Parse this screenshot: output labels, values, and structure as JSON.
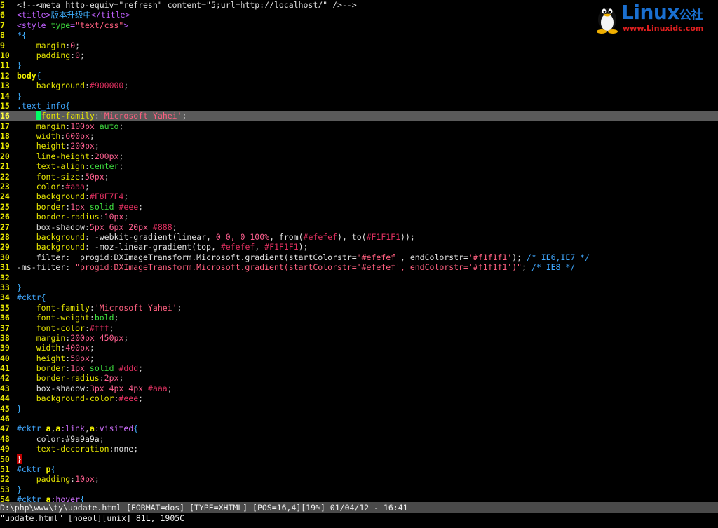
{
  "editor": {
    "lines": [
      {
        "n": "5",
        "tokens": [
          [
            "c-cmt",
            "<!--<meta http-equiv=\"refresh\" content=\"5;url=http://localhost/\" />-->"
          ]
        ]
      },
      {
        "n": "6",
        "tokens": [
          [
            "c-tag",
            "<title>"
          ],
          [
            "c-txt",
            "版本升级中"
          ],
          [
            "c-tag",
            "</title>"
          ]
        ]
      },
      {
        "n": "7",
        "tokens": [
          [
            "c-tag",
            "<style "
          ],
          [
            "c-val",
            "type"
          ],
          [
            "c-tag",
            "="
          ],
          [
            "c-str",
            "\"text/css\""
          ],
          [
            "c-tag",
            ">"
          ]
        ]
      },
      {
        "n": "8",
        "tokens": [
          [
            "c-sel",
            "*"
          ],
          [
            "c-brace",
            "{"
          ]
        ]
      },
      {
        "n": "9",
        "tokens": [
          [
            "",
            "    "
          ],
          [
            "c-prop",
            "margin"
          ],
          [
            "",
            ":"
          ],
          [
            "c-num",
            "0"
          ],
          [
            "",
            ";"
          ]
        ]
      },
      {
        "n": "10",
        "tokens": [
          [
            "",
            "    "
          ],
          [
            "c-prop",
            "padding"
          ],
          [
            "",
            ":"
          ],
          [
            "c-num",
            "0"
          ],
          [
            "",
            ";"
          ]
        ]
      },
      {
        "n": "11",
        "tokens": [
          [
            "c-brace",
            "}"
          ]
        ]
      },
      {
        "n": "12",
        "tokens": [
          [
            "c-propb",
            "body"
          ],
          [
            "c-brace",
            "{"
          ]
        ]
      },
      {
        "n": "13",
        "tokens": [
          [
            "",
            "    "
          ],
          [
            "c-prop",
            "background"
          ],
          [
            "",
            ":"
          ],
          [
            "c-hex",
            "#900000"
          ],
          [
            "",
            ";"
          ]
        ]
      },
      {
        "n": "14",
        "tokens": [
          [
            "c-brace",
            "}"
          ]
        ]
      },
      {
        "n": "15",
        "tokens": [
          [
            "c-sel",
            ".text_info"
          ],
          [
            "c-brace",
            "{"
          ]
        ]
      },
      {
        "n": "16",
        "cur": true,
        "tokens": [
          [
            "",
            "    "
          ],
          [
            "cursor",
            ""
          ],
          [
            "c-prop",
            "font-family"
          ],
          [
            "",
            ":"
          ],
          [
            "c-str",
            "'Microsoft Yahei'"
          ],
          [
            "",
            ";"
          ]
        ]
      },
      {
        "n": "17",
        "tokens": [
          [
            "",
            "    "
          ],
          [
            "c-prop",
            "margin"
          ],
          [
            "",
            ":"
          ],
          [
            "c-num",
            "100px"
          ],
          [
            "",
            " "
          ],
          [
            "c-val",
            "auto"
          ],
          [
            "",
            ";"
          ]
        ]
      },
      {
        "n": "18",
        "tokens": [
          [
            "",
            "    "
          ],
          [
            "c-prop",
            "width"
          ],
          [
            "",
            ":"
          ],
          [
            "c-num",
            "600px"
          ],
          [
            "",
            ";"
          ]
        ]
      },
      {
        "n": "19",
        "tokens": [
          [
            "",
            "    "
          ],
          [
            "c-prop",
            "height"
          ],
          [
            "",
            ":"
          ],
          [
            "c-num",
            "200px"
          ],
          [
            "",
            ";"
          ]
        ]
      },
      {
        "n": "20",
        "tokens": [
          [
            "",
            "    "
          ],
          [
            "c-prop",
            "line-height"
          ],
          [
            "",
            ":"
          ],
          [
            "c-num",
            "200px"
          ],
          [
            "",
            ";"
          ]
        ]
      },
      {
        "n": "21",
        "tokens": [
          [
            "",
            "    "
          ],
          [
            "c-prop",
            "text-align"
          ],
          [
            "",
            ":"
          ],
          [
            "c-val",
            "center"
          ],
          [
            "",
            ";"
          ]
        ]
      },
      {
        "n": "22",
        "tokens": [
          [
            "",
            "    "
          ],
          [
            "c-prop",
            "font-size"
          ],
          [
            "",
            ":"
          ],
          [
            "c-num",
            "50px"
          ],
          [
            "",
            ";"
          ]
        ]
      },
      {
        "n": "23",
        "tokens": [
          [
            "",
            "    "
          ],
          [
            "c-prop",
            "color"
          ],
          [
            "",
            ":"
          ],
          [
            "c-hex",
            "#aaa"
          ],
          [
            "",
            ";"
          ]
        ]
      },
      {
        "n": "24",
        "tokens": [
          [
            "",
            "    "
          ],
          [
            "c-prop",
            "background"
          ],
          [
            "",
            ":"
          ],
          [
            "c-hex",
            "#F8F7F4"
          ],
          [
            "",
            ";"
          ]
        ]
      },
      {
        "n": "25",
        "tokens": [
          [
            "",
            "    "
          ],
          [
            "c-prop",
            "border"
          ],
          [
            "",
            ":"
          ],
          [
            "c-num",
            "1px"
          ],
          [
            "",
            " "
          ],
          [
            "c-val",
            "solid"
          ],
          [
            "",
            " "
          ],
          [
            "c-hex",
            "#eee"
          ],
          [
            "",
            ";"
          ]
        ]
      },
      {
        "n": "26",
        "tokens": [
          [
            "",
            "    "
          ],
          [
            "c-prop",
            "border-radius"
          ],
          [
            "",
            ":"
          ],
          [
            "c-num",
            "10px"
          ],
          [
            "",
            ";"
          ]
        ]
      },
      {
        "n": "27",
        "tokens": [
          [
            "",
            "    "
          ],
          [
            "c-fn",
            "box-shadow"
          ],
          [
            "",
            ":"
          ],
          [
            "c-num",
            "5px 6px 20px"
          ],
          [
            "",
            " "
          ],
          [
            "c-hex",
            "#888"
          ],
          [
            "",
            ";"
          ]
        ]
      },
      {
        "n": "28",
        "tokens": [
          [
            "",
            "    "
          ],
          [
            "c-prop",
            "background"
          ],
          [
            "",
            ": "
          ],
          [
            "c-fn",
            "-webkit-gradient(linear, "
          ],
          [
            "c-num",
            "0 0, 0 100%"
          ],
          [
            "c-fn",
            ", from("
          ],
          [
            "c-hex",
            "#efefef"
          ],
          [
            "c-fn",
            "), to("
          ],
          [
            "c-hex",
            "#F1F1F1"
          ],
          [
            "c-fn",
            "));"
          ]
        ]
      },
      {
        "n": "29",
        "tokens": [
          [
            "",
            "    "
          ],
          [
            "c-prop",
            "background"
          ],
          [
            "",
            ": "
          ],
          [
            "c-fn",
            "-moz-linear-gradient(top, "
          ],
          [
            "c-hex",
            "#efefef"
          ],
          [
            "c-fn",
            ", "
          ],
          [
            "c-hex",
            "#F1F1F1"
          ],
          [
            "c-fn",
            ");"
          ]
        ]
      },
      {
        "n": "30",
        "tokens": [
          [
            "",
            "    "
          ],
          [
            "c-fn",
            "filter:  progid:DXImageTransform.Microsoft.gradient(startColorstr="
          ],
          [
            "c-str",
            "'#efefef'"
          ],
          [
            "c-fn",
            ", endColorstr="
          ],
          [
            "c-str",
            "'#f1f1f1'"
          ],
          [
            "c-fn",
            "); "
          ],
          [
            "c-sel",
            "/* IE6,IE7 */"
          ]
        ]
      },
      {
        "n": "31",
        "tokens": [
          [
            "c-fn",
            "-ms-filter: "
          ],
          [
            "c-str",
            "\"progid:DXImageTransform.Microsoft.gradient(startColorstr='#efefef', endColorstr='#f1f1f1')\""
          ],
          [
            "c-fn",
            "; "
          ],
          [
            "c-sel",
            "/* IE8 */"
          ]
        ]
      },
      {
        "n": "32",
        "tokens": []
      },
      {
        "n": "33",
        "tokens": [
          [
            "c-brace",
            "}"
          ]
        ]
      },
      {
        "n": "34",
        "tokens": [
          [
            "c-sel",
            "#cktr"
          ],
          [
            "c-brace",
            "{"
          ]
        ]
      },
      {
        "n": "35",
        "tokens": [
          [
            "",
            "    "
          ],
          [
            "c-prop",
            "font-family"
          ],
          [
            "",
            ":"
          ],
          [
            "c-str",
            "'Microsoft Yahei'"
          ],
          [
            "",
            ";"
          ]
        ]
      },
      {
        "n": "36",
        "tokens": [
          [
            "",
            "    "
          ],
          [
            "c-prop",
            "font-weight"
          ],
          [
            "",
            ":"
          ],
          [
            "c-val",
            "bold"
          ],
          [
            "",
            ";"
          ]
        ]
      },
      {
        "n": "37",
        "tokens": [
          [
            "",
            "    "
          ],
          [
            "c-prop",
            "font-color"
          ],
          [
            "",
            ":"
          ],
          [
            "c-hex",
            "#fff"
          ],
          [
            "",
            ";"
          ]
        ]
      },
      {
        "n": "38",
        "tokens": [
          [
            "",
            "    "
          ],
          [
            "c-prop",
            "margin"
          ],
          [
            "",
            ":"
          ],
          [
            "c-num",
            "200px 450px"
          ],
          [
            "",
            ";"
          ]
        ]
      },
      {
        "n": "39",
        "tokens": [
          [
            "",
            "    "
          ],
          [
            "c-prop",
            "width"
          ],
          [
            "",
            ":"
          ],
          [
            "c-num",
            "400px"
          ],
          [
            "",
            ";"
          ]
        ]
      },
      {
        "n": "40",
        "tokens": [
          [
            "",
            "    "
          ],
          [
            "c-prop",
            "height"
          ],
          [
            "",
            ":"
          ],
          [
            "c-num",
            "50px"
          ],
          [
            "",
            ";"
          ]
        ]
      },
      {
        "n": "41",
        "tokens": [
          [
            "",
            "    "
          ],
          [
            "c-prop",
            "border"
          ],
          [
            "",
            ":"
          ],
          [
            "c-num",
            "1px"
          ],
          [
            "",
            " "
          ],
          [
            "c-val",
            "solid"
          ],
          [
            "",
            " "
          ],
          [
            "c-hex",
            "#ddd"
          ],
          [
            "",
            ";"
          ]
        ]
      },
      {
        "n": "42",
        "tokens": [
          [
            "",
            "    "
          ],
          [
            "c-prop",
            "border-radius"
          ],
          [
            "",
            ":"
          ],
          [
            "c-num",
            "2px"
          ],
          [
            "",
            ";"
          ]
        ]
      },
      {
        "n": "43",
        "tokens": [
          [
            "",
            "    "
          ],
          [
            "c-fn",
            "box-shadow"
          ],
          [
            "",
            ":"
          ],
          [
            "c-num",
            "3px 4px 4px"
          ],
          [
            "",
            " "
          ],
          [
            "c-hex",
            "#aaa"
          ],
          [
            "",
            ";"
          ]
        ]
      },
      {
        "n": "44",
        "tokens": [
          [
            "",
            "    "
          ],
          [
            "c-prop",
            "background-color"
          ],
          [
            "",
            ":"
          ],
          [
            "c-hex",
            "#eee"
          ],
          [
            "",
            ";"
          ]
        ]
      },
      {
        "n": "45",
        "tokens": [
          [
            "c-brace",
            "}"
          ]
        ]
      },
      {
        "n": "46",
        "tokens": []
      },
      {
        "n": "47",
        "tokens": [
          [
            "c-sel",
            "#cktr "
          ],
          [
            "c-propb",
            "a"
          ],
          [
            "",
            ","
          ],
          [
            "c-propb",
            "a"
          ],
          [
            "c-pseudo",
            ":link"
          ],
          [
            "",
            ","
          ],
          [
            "c-propb",
            "a"
          ],
          [
            "c-pseudo",
            ":visited"
          ],
          [
            "c-brace",
            "{"
          ]
        ]
      },
      {
        "n": "48",
        "tokens": [
          [
            "",
            "    "
          ],
          [
            "c-fn",
            "color:#9a9a9a;"
          ]
        ]
      },
      {
        "n": "49",
        "tokens": [
          [
            "",
            "    "
          ],
          [
            "c-prop",
            "text-decoration"
          ],
          [
            "",
            ":"
          ],
          [
            "c-fn",
            "none;"
          ]
        ]
      },
      {
        "n": "50",
        "tokens": [
          [
            "matchbrace",
            "}"
          ]
        ]
      },
      {
        "n": "51",
        "tokens": [
          [
            "c-sel",
            "#cktr "
          ],
          [
            "c-propb",
            "p"
          ],
          [
            "c-brace",
            "{"
          ]
        ]
      },
      {
        "n": "52",
        "tokens": [
          [
            "",
            "    "
          ],
          [
            "c-prop",
            "padding"
          ],
          [
            "",
            ":"
          ],
          [
            "c-num",
            "10px"
          ],
          [
            "",
            ";"
          ]
        ]
      },
      {
        "n": "53",
        "tokens": [
          [
            "c-brace",
            "}"
          ]
        ]
      },
      {
        "n": "54",
        "tokens": [
          [
            "c-sel",
            "#cktr "
          ],
          [
            "c-propb",
            "a"
          ],
          [
            "c-pseudo",
            ":hover"
          ],
          [
            "c-brace",
            "{"
          ]
        ]
      }
    ],
    "statusline": "D:\\php\\www\\ty\\update.html [FORMAT=dos] [TYPE=XHTML] [POS=16,4][19%] 01/04/12 - 16:41",
    "cmdline": "\"update.html\" [noeol][unix] 81L, 1905C"
  },
  "watermark": {
    "brand": "Linux",
    "brand_suffix": "公社",
    "url": "www.Linuxidc.com",
    "icon": "tux-penguin-icon"
  }
}
